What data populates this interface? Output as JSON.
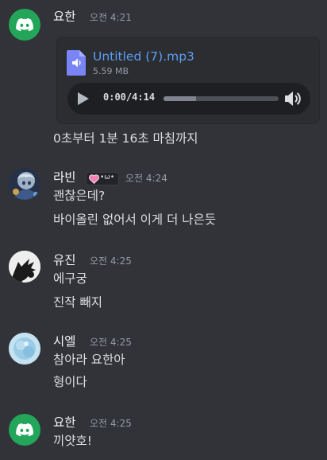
{
  "messages": [
    {
      "username": "요한",
      "timestamp": "오전 4:21",
      "avatar": "discord-logo-icon",
      "avatar_color": "#23a55a",
      "attachment": {
        "file_name": "Untitled (7).mp3",
        "file_size": "5.59 MB",
        "current_time": "0:00",
        "separator": "/",
        "duration": "4:14",
        "buffered_fraction": 0.28,
        "played_fraction": 0.0
      },
      "lines": [
        "0초부터 1분 16초 마침까지"
      ]
    },
    {
      "username": "라빈",
      "timestamp": "오전 4:24",
      "avatar": "character-avatar-icon",
      "badge": {
        "icon": "pink-heart-icon",
        "text": "•ω•"
      },
      "lines": [
        "괜찮은데?",
        "바이올린 없어서 이게 더 나은듯"
      ]
    },
    {
      "username": "유진",
      "timestamp": "오전 4:25",
      "avatar": "cat-silhouette-avatar-icon",
      "lines": [
        "에구궁",
        "진작 빼지"
      ]
    },
    {
      "username": "시엘",
      "timestamp": "오전 4:25",
      "avatar": "blue-watercolor-avatar-icon",
      "lines": [
        "참아라 요한아",
        "형이다"
      ]
    },
    {
      "username": "요한",
      "timestamp": "오전 4:25",
      "avatar": "discord-logo-icon",
      "avatar_color": "#23a55a",
      "lines": [
        "끼얏호!"
      ]
    }
  ],
  "colors": {
    "background": "#313338",
    "accent": "#5865f2",
    "link": "#5d9ef5"
  }
}
